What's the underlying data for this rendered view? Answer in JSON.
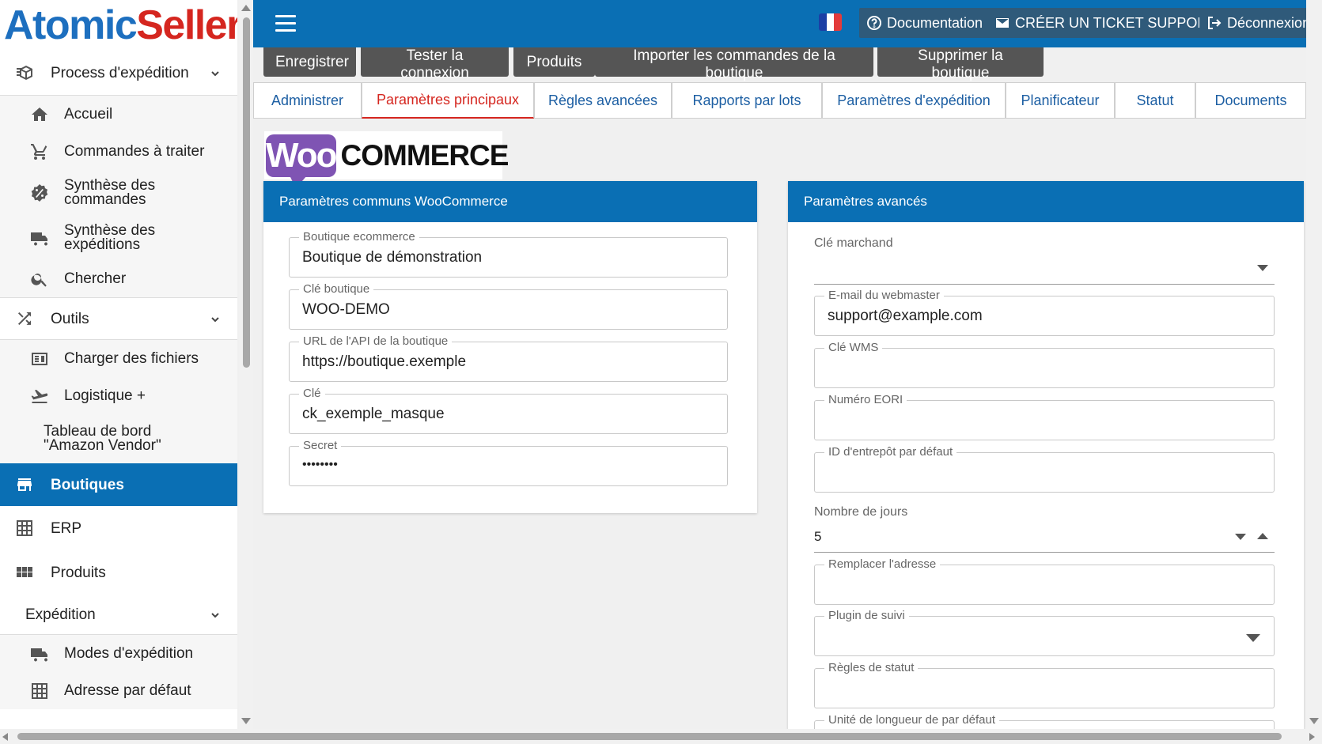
{
  "brand": {
    "part1": "Atomic",
    "part2": "Seller",
    "color1": "#1d6fbf",
    "color2": "#d5261f"
  },
  "colors": {
    "primary": "#0a6fb4",
    "active_tab": "#d5261f",
    "woo_purple": "#7f54b3"
  },
  "sidebar": {
    "process": {
      "label": "Process d'expédition",
      "icon": "process-icon"
    },
    "process_items": [
      {
        "label": "Accueil",
        "icon": "home-icon"
      },
      {
        "label": "Commandes à traiter",
        "icon": "cart-icon"
      },
      {
        "label": "Synthèse des commandes",
        "icon": "badge-percent-icon"
      },
      {
        "label": "Synthèse des expéditions",
        "icon": "truck-icon"
      },
      {
        "label": "Chercher",
        "icon": "search-icon"
      }
    ],
    "outils": {
      "label": "Outils",
      "icon": "shuffle-icon"
    },
    "outils_items": [
      {
        "label": "Charger des fichiers",
        "icon": "upload-file-icon"
      },
      {
        "label": "Logistique +",
        "icon": "plane-icon"
      },
      {
        "label": "Tableau de bord \"Amazon Vendor\""
      }
    ],
    "boutiques": {
      "label": "Boutiques",
      "icon": "store-icon"
    },
    "erp": {
      "label": "ERP",
      "icon": "grid-icon"
    },
    "produits": {
      "label": "Produits",
      "icon": "apps-icon"
    },
    "expedition": {
      "label": "Expédition"
    },
    "expedition_items": [
      {
        "label": "Modes d'expédition",
        "icon": "truck-icon"
      },
      {
        "label": "Adresse par défaut",
        "icon": "grid-icon"
      }
    ]
  },
  "topbar": {
    "menu_icon": "hamburger-icon",
    "flag": "france-flag-icon",
    "documentation": "Documentation",
    "ticket": "CRÉER UN TICKET SUPPORT",
    "logout": "Déconnexion"
  },
  "actions": [
    "Enregistrer",
    "Tester la connexion",
    "Produits",
    "Importer les commandes de la boutique",
    "Supprimer la boutique"
  ],
  "tabs": [
    "Administrer",
    "Paramètres principaux",
    "Règles avancées",
    "Rapports par lots",
    "Paramètres d'expédition",
    "Planificateur",
    "Statut",
    "Documents"
  ],
  "woo": {
    "left": "Woo",
    "right": "COMMERCE"
  },
  "common_panel": {
    "title": "Paramètres communs WooCommerce",
    "fields": [
      {
        "label": "Boutique ecommerce",
        "value": "Boutique de démonstration"
      },
      {
        "label": "Clé boutique",
        "value": "WOO-DEMO"
      },
      {
        "label": "URL de l'API de la boutique",
        "value": "https://boutique.exemple"
      },
      {
        "label": "Clé",
        "value": "ck_exemple_masque"
      },
      {
        "label": "Secret",
        "value": "••••••••"
      }
    ]
  },
  "advanced_panel": {
    "title": "Paramètres avancés",
    "merchant_key": {
      "label": "Clé marchand",
      "value": ""
    },
    "webmaster_email": {
      "label": "E-mail du webmaster",
      "value": "support@example.com"
    },
    "wms_key": {
      "label": "Clé WMS",
      "value": ""
    },
    "eori": {
      "label": "Numéro EORI",
      "value": ""
    },
    "warehouse": {
      "label": "ID d'entrepôt par défaut",
      "value": ""
    },
    "days": {
      "label": "Nombre de jours",
      "value": "5"
    },
    "replace_address": {
      "label": "Remplacer l'adresse",
      "value": ""
    },
    "tracking_plugin": {
      "label": "Plugin de suivi",
      "value": ""
    },
    "status_rules": {
      "label": "Règles de statut",
      "value": ""
    },
    "length_unit": {
      "label": "Unité de longueur de par défaut",
      "value": ""
    }
  }
}
